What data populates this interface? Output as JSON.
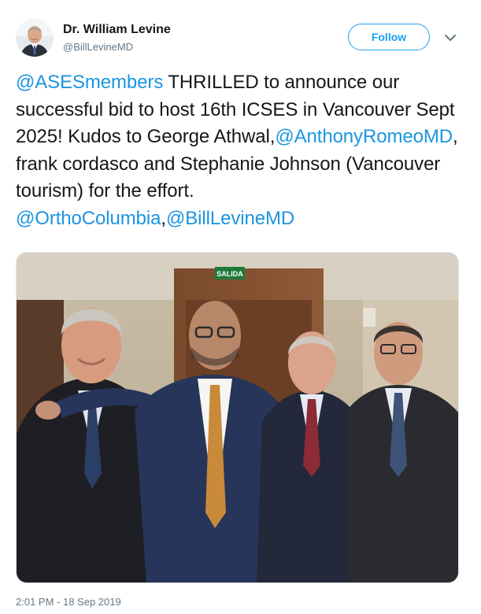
{
  "author": {
    "name": "Dr. William Levine",
    "handle": "@BillLevineMD"
  },
  "follow_button": {
    "label": "Follow"
  },
  "tweet": {
    "mention_1": "@ASESmembers",
    "text_1": " THRILLED to announce our successful bid to host 16th ICSES in Vancouver Sept 2025! Kudos to George Athwal,",
    "mention_2": "@AnthonyRomeoMD",
    "text_2": ", frank cordasco and Stephanie Johnson (Vancouver tourism) for the effort.",
    "mention_3": "@OrthoColumbia",
    "separator": ",",
    "mention_4": "@BillLevineMD"
  },
  "photo": {
    "sign_text": "SALIDA"
  },
  "timestamp": "2:01 PM - 18 Sep 2019",
  "colors": {
    "link": "#1b95e0",
    "follow": "#1da1f2",
    "meta": "#657786"
  },
  "icons": [
    "avatar",
    "chevron-down-icon"
  ]
}
